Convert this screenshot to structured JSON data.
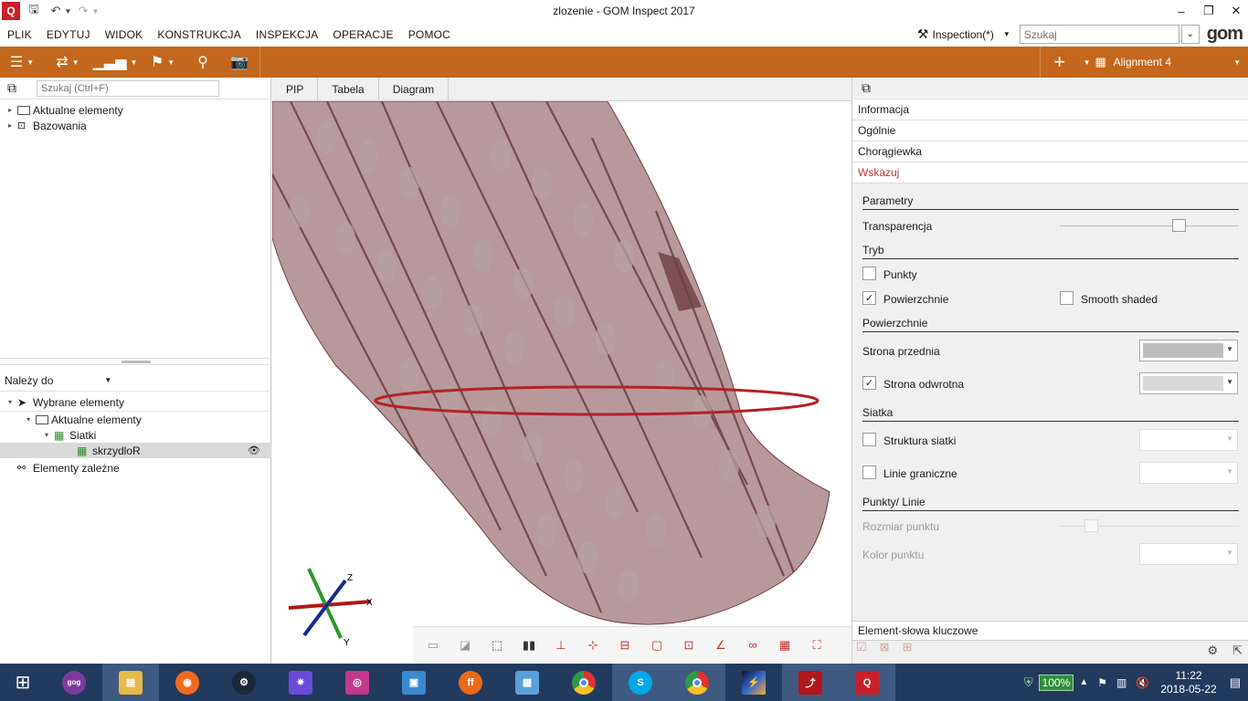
{
  "window": {
    "title": "zlozenie - GOM Inspect 2017",
    "minimize": "–",
    "maximize": "❐",
    "close": "✕"
  },
  "menu": {
    "items": [
      "PLIK",
      "EDYTUJ",
      "WIDOK",
      "KONSTRUKCJA",
      "INSPEKCJA",
      "OPERACJE",
      "POMOC"
    ],
    "workspace": "Inspection(*)",
    "search_placeholder": "Szukaj",
    "logo": "gom"
  },
  "toolbar": {
    "alignment": "Alignment 4"
  },
  "left_panel": {
    "search_placeholder": "Szukaj (Ctrl+F)",
    "tree_top": [
      "Aktualne elementy",
      "Bazowania"
    ],
    "belongs_to": "Należy do",
    "tree_bottom": {
      "selected": "Wybrane elementy",
      "actual": "Aktualne elementy",
      "meshes": "Siatki",
      "mesh_item": "skrzydloR",
      "dependent": "Elementy zależne"
    }
  },
  "tabs": [
    "PIP",
    "Tabela",
    "Diagram"
  ],
  "axes": {
    "x": "X",
    "y": "Y",
    "z": "Z"
  },
  "right_panel": {
    "sections": [
      "Informacja",
      "Ogólnie",
      "Chorągiewka",
      "Wskazuj"
    ],
    "groups": {
      "params": "Parametry",
      "mode": "Tryb",
      "surfaces": "Powierzchnie",
      "mesh": "Siatka",
      "points_lines": "Punkty/ Linie"
    },
    "props": {
      "transparency": "Transparencja",
      "points": "Punkty",
      "surfaces": "Powierzchnie",
      "smooth": "Smooth shaded",
      "front_side": "Strona przednia",
      "back_side": "Strona odwrotna",
      "mesh_structure": "Struktura siatki",
      "boundary_lines": "Linie graniczne",
      "point_size": "Rozmiar punktu",
      "point_color": "Kolor punktu"
    },
    "values": {
      "transparency_level": 0.68,
      "front_color": "#bdbdbd",
      "back_color": "#d8d8d8",
      "points_checked": false,
      "surfaces_checked": true,
      "smooth_checked": false,
      "back_checked": true,
      "mesh_structure_checked": false,
      "boundary_checked": false
    },
    "keywords": "Element-słowa kluczowe"
  },
  "taskbar": {
    "battery": "100%",
    "time": "11:22",
    "date": "2018-05-22",
    "apps": [
      "start-icon",
      "gog-icon",
      "file-explorer-icon",
      "origin-icon",
      "steam-icon",
      "settings-icon",
      "camera-icon",
      "control-panel-icon",
      "firefox-icon",
      "calculator-icon",
      "chrome-icon",
      "skype-icon",
      "chrome-2-icon",
      "image-viewer-icon",
      "acrobat-icon",
      "gom-inspect-icon"
    ]
  },
  "colors": {
    "toolbar": "#c2671d",
    "accent_red": "#c23030",
    "mesh_fill": "#8a5a5e",
    "taskbar": "#223a5e"
  }
}
